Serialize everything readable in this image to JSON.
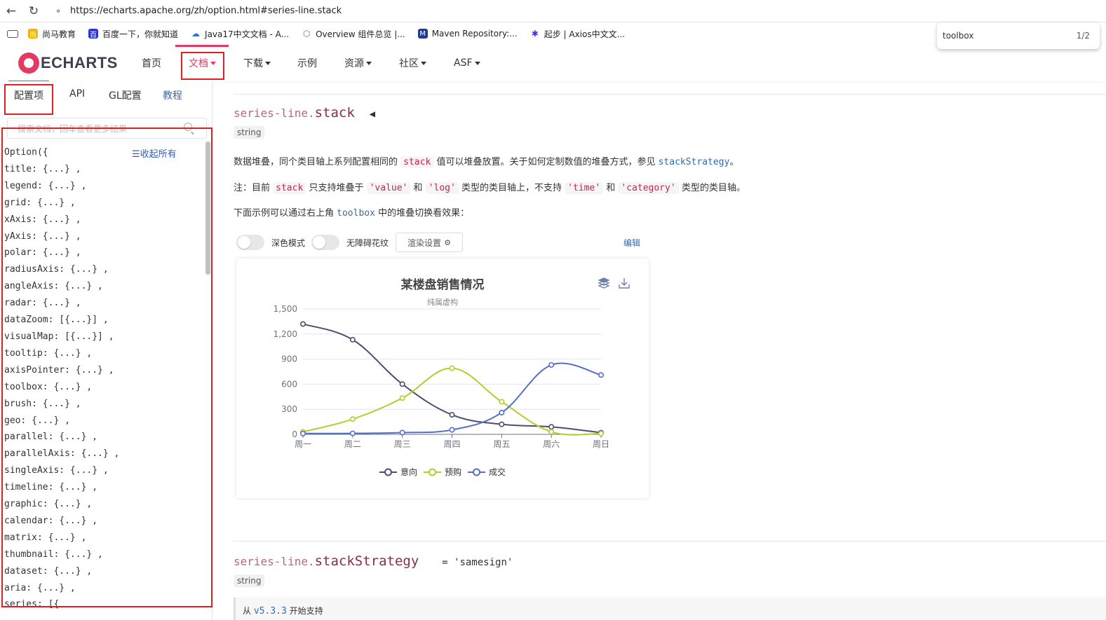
{
  "browser": {
    "url": "https://echarts.apache.org/zh/option.html#series-line.stack",
    "bookmarks": [
      {
        "label": "尚马教育",
        "icon": "shangma-icon",
        "color": "#f5b400"
      },
      {
        "label": "百度一下，你就知道",
        "icon": "baidu-icon",
        "color": "#2932e1"
      },
      {
        "label": "Java17中文文档 - A...",
        "icon": "cloud-icon",
        "color": "#1a73e8"
      },
      {
        "label": "Overview 组件总览 |...",
        "icon": "overview-icon",
        "color": "#4a6ee0"
      },
      {
        "label": "Maven Repository:...",
        "icon": "maven-icon",
        "color": "#1f3a93"
      },
      {
        "label": "起步 | Axios中文文...",
        "icon": "axios-icon",
        "color": "#5a29e4"
      }
    ],
    "find": {
      "query": "toolbox",
      "count": "1/2"
    }
  },
  "header": {
    "logo_text": "ECHARTS",
    "nav": [
      "首页",
      "文档",
      "下载",
      "示例",
      "资源",
      "社区",
      "ASF"
    ]
  },
  "sidebar": {
    "tabs": [
      "配置项",
      "API",
      "GL配置",
      "教程"
    ],
    "search_placeholder": "搜索文档，回车查看更多结果",
    "collapse_all": "收起所有",
    "root": "Option({",
    "items": [
      "title: {...} ,",
      "legend: {...} ,",
      "grid: {...} ,",
      "xAxis: {...} ,",
      "yAxis: {...} ,",
      "polar: {...} ,",
      "radiusAxis: {...} ,",
      "angleAxis: {...} ,",
      "radar: {...} ,",
      "dataZoom: [{...}] ,",
      "visualMap: [{...}] ,",
      "tooltip: {...} ,",
      "axisPointer: {...} ,",
      "toolbox: {...} ,",
      "brush: {...} ,",
      "geo: {...} ,",
      "parallel: {...} ,",
      "parallelAxis: {...} ,",
      "singleAxis: {...} ,",
      "timeline: {...} ,",
      "graphic: {...} ,",
      "calendar: {...} ,",
      "matrix: {...} ,",
      "thumbnail: {...} ,",
      "dataset: {...} ,",
      "aria: {...} ,",
      "series: [{"
    ]
  },
  "doc": {
    "prefix": "series-line.",
    "name": "stack",
    "type": "string",
    "p1_a": "数据堆叠，同个类目轴上系列配置相同的",
    "p1_code": "stack",
    "p1_b": "值可以堆叠放置。关于如何定制数值的堆叠方式，参见",
    "p1_link": "stackStrategy",
    "p1_c": "。",
    "p2_a": "注：目前",
    "p2_code1": "stack",
    "p2_b": "只支持堆叠于",
    "p2_code2": "'value'",
    "p2_c": "和",
    "p2_code3": "'log'",
    "p2_d": "类型的类目轴上，不支持",
    "p2_code4": "'time'",
    "p2_e": "和",
    "p2_code5": "'category'",
    "p2_f": "类型的类目轴。",
    "p3_a": "下面示例可以通过右上角",
    "p3_link": "toolbox",
    "p3_b": "中的堆叠切换看效果：",
    "controls": {
      "dark_mode": "深色模式",
      "aria_pattern": "无障碍花纹",
      "render": "渲染设置",
      "edit": "编辑"
    },
    "next_prefix": "series-line.",
    "next_name": "stackStrategy",
    "next_default": "= 'samesign'",
    "next_type": "string",
    "since_a": "从",
    "since_ver": "v5.3.3",
    "since_b": "开始支持"
  },
  "chart_data": {
    "type": "line",
    "title": "某楼盘销售情况",
    "subtitle": "纯属虚构",
    "categories": [
      "周一",
      "周二",
      "周三",
      "周四",
      "周五",
      "周六",
      "周日"
    ],
    "ylim": [
      0,
      1500
    ],
    "yticks": [
      "0",
      "300",
      "600",
      "900",
      "1,200",
      "1,500"
    ],
    "smooth": true,
    "legend_position": "bottom",
    "series": [
      {
        "name": "意向",
        "color": "#4b4e70",
        "values": [
          1320,
          1132,
          601,
          234,
          120,
          90,
          20
        ]
      },
      {
        "name": "预购",
        "color": "#b4cc2e",
        "values": [
          30,
          182,
          434,
          791,
          390,
          30,
          10
        ]
      },
      {
        "name": "成交",
        "color": "#5470c6",
        "values": [
          10,
          12,
          21,
          54,
          260,
          830,
          710
        ]
      }
    ],
    "toolbox": [
      "stack-icon",
      "download-icon"
    ]
  }
}
